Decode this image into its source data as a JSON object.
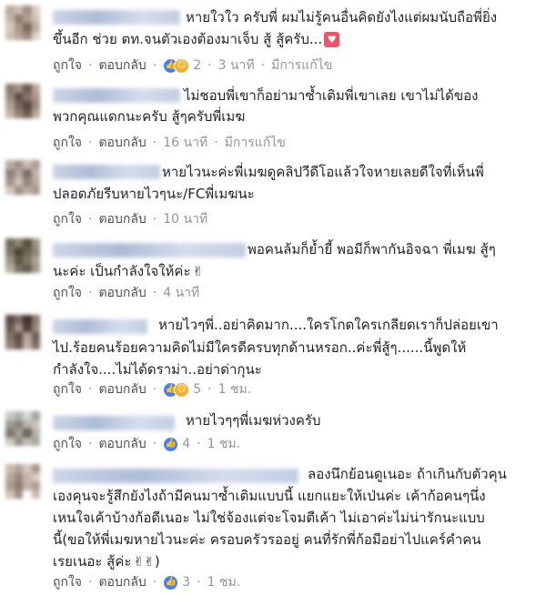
{
  "actions": {
    "like_label": "ถูกใจ",
    "reply_label": "ตอบกลับ",
    "separator": "·",
    "edited_label": "มีการแก้ไข"
  },
  "comments": [
    {
      "lines": [
        "หายใวใว ครับพี่ ผมไม่รู้คนอื่นคิดยังไงแต่ผมนับถือพี่ยิ่ง",
        "ขึ้นอีก ช่วย ตท.จนตัวเองต้องมาเจ็บ สู้ สู้ครับ..."
      ],
      "reactions": "2",
      "time": "3 นาที",
      "edited": true
    },
    {
      "lines": [
        "ไม่ชอบพี่เขาก็อย่ามาซ้ำเติมพี่เขาเลย เขาไม่ได้ของ",
        "พวกคุณแดกนะครับ สู้ๆครับพี่เมฆ"
      ],
      "reactions": "",
      "time": "16 นาที",
      "edited": true
    },
    {
      "lines": [
        "หายไวนะค่ะพี่เมฆดูคลิปวีดีโอแล้วใจหายเลยดีใจที่เห็นพี่",
        "ปลอดภัยรีบหายไวๆนะ/FCพี่เมฆนะ"
      ],
      "reactions": "",
      "time": "10 นาที",
      "edited": false
    },
    {
      "lines": [
        "พอคนล้มก็ย้ำยี้ พอมีก็พากันอิจฉา พี่เมฆ สู้ๆ",
        "นะค่ะ เป็นกำลังใจให้ค่ะ"
      ],
      "reactions": "",
      "time": "4 นาที",
      "edited": false
    },
    {
      "lines": [
        "หายไวๆพี่..อย่าคิดมาก....ใครโกดใครเกลียดเราก็ปล่อยเขา",
        "ไป.ร้อยคนร้อยความคิดไม่มีใครดีครบทุกด้านหรอก..ค่ะพี่สู้ๆ......นี้พูดให้",
        "กำลังใจ....ไม่ได้ดราม่า..อย่าด่ากุนะ"
      ],
      "reactions": "5",
      "time": "1 ชม.",
      "edited": false
    },
    {
      "lines": [
        "หายไวๆๆพี่เมฆห่วงครับ"
      ],
      "reactions": "4",
      "time": "1 ชม.",
      "edited": false
    },
    {
      "lines": [
        "ลองนึกย้อนดูเนอะ ถ้าเกินกับตัวคุน",
        "เองคุนจะรู้สึกยังไงถ้ามีคนมาซ้ำเติมแบบนี้ แยกแยะให้เป่นค่ะ เค้าก้อคนๆนึ่ง",
        "เหนใจเค้าบ้างก้อดีเนอะ ไม่ใช่จ้องแต่จะโจมตีเค้า ไม่เอาค่ะไม่น่ารักนะแบบ",
        "นี้(ขอให้พี่เมฆหายไวนะค่ะ ครอบครัวรออยู่ คนที่รักพี่ก้อมีอย่าไปแคร์คำคน",
        "เรยเนอะ สู้ค่ะ"
      ],
      "reactions": "3",
      "time": "1 ชม.",
      "edited": false
    }
  ]
}
